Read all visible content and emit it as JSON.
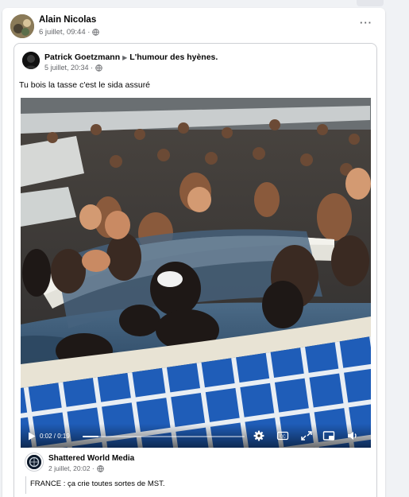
{
  "post": {
    "author": "Alain Nicolas",
    "meta": "6 juillet, 09:44 ·",
    "more_label": "···"
  },
  "shared": {
    "author": "Patrick Goetzmann",
    "arrow": "▶",
    "group": "L'humour des hyènes.",
    "meta": "5 juillet, 20:34 ·",
    "text": "Tu bois la tasse c'est le sida assuré"
  },
  "video": {
    "time": "0:02 / 0:19",
    "progress": 0.1,
    "controls": [
      "settings-icon",
      "captions-icon",
      "expand-icon",
      "miniplayer-icon",
      "volume-icon"
    ]
  },
  "quoted": {
    "author": "Shattered World Media",
    "meta": "2 juillet, 20:02 ·",
    "text": "FRANCE : ça crie toutes sortes de MST."
  },
  "colors": {
    "background": "#f0f2f5",
    "card": "#ffffff",
    "secondary_text": "#65676b",
    "pool_tile": "#1f5db8",
    "pool_water": "#3b5a78"
  }
}
